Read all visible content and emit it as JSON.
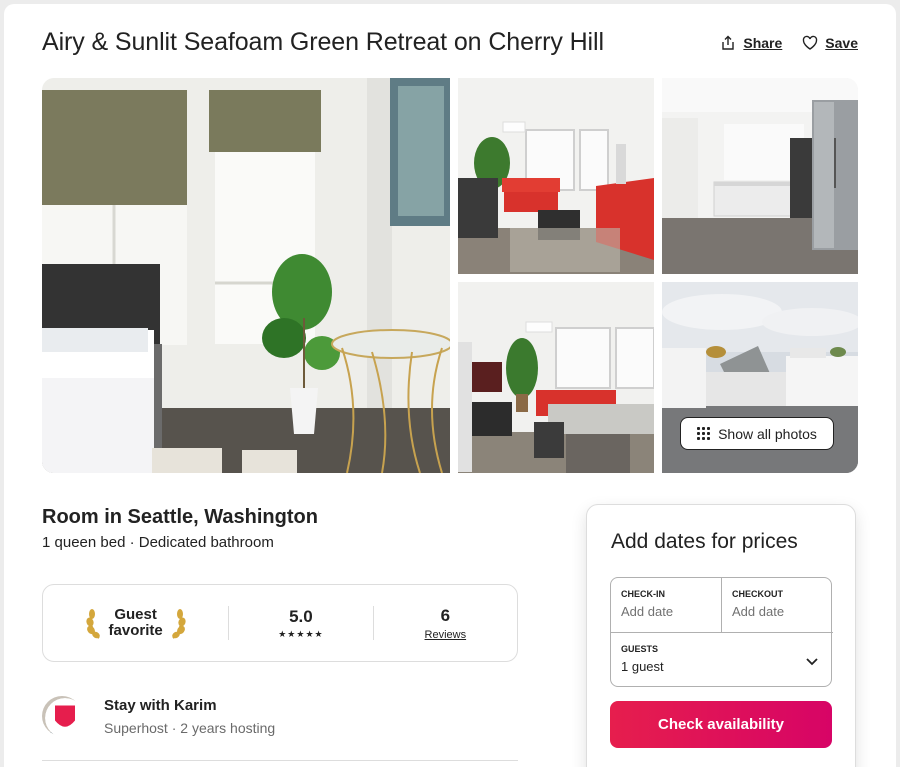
{
  "listing": {
    "title": "Airy & Sunlit Seafoam Green Retreat on Cherry Hill",
    "share_label": "Share",
    "save_label": "Save",
    "show_all_photos_label": "Show all photos",
    "room_title": "Room in Seattle, Washington",
    "room_subtitle": "1 queen bed · Dedicated bathroom"
  },
  "guest_favorite": {
    "label": "Guest favorite",
    "rating": "5.0",
    "stars": "★★★★★",
    "review_count": "6",
    "reviews_label": "Reviews"
  },
  "host": {
    "name": "Stay with Karim",
    "details": "Superhost · 2 years hosting"
  },
  "booking": {
    "title": "Add dates for prices",
    "checkin_label": "CHECK-IN",
    "checkin_value": "Add date",
    "checkout_label": "CHECKOUT",
    "checkout_value": "Add date",
    "guests_label": "GUESTS",
    "guests_value": "1 guest",
    "button_label": "Check availability"
  },
  "colors": {
    "brand": "#e61e4d",
    "text": "#222222",
    "muted": "#6a6a6a"
  },
  "icons": [
    "share-icon",
    "heart-icon",
    "grid-dots-icon",
    "laurel-left-icon",
    "laurel-right-icon",
    "superhost-badge-icon",
    "chevron-down-icon"
  ]
}
